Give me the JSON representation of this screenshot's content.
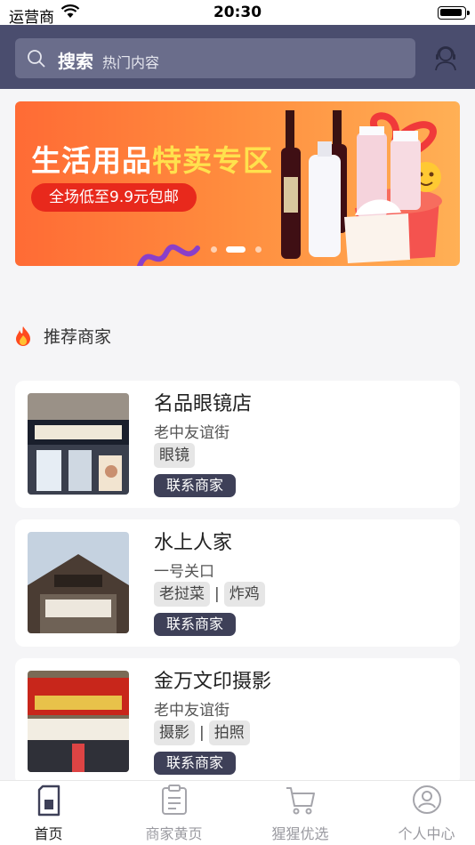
{
  "status_bar": {
    "carrier": "运营商",
    "time": "20:30"
  },
  "search": {
    "label": "搜索",
    "hint": "热门内容"
  },
  "banner": {
    "title_part1": "生活用品",
    "title_part2": "特卖专区",
    "pill_text": "全场低至9.9元包邮",
    "slide_count": 3,
    "active_slide": 1
  },
  "section": {
    "title": "推荐商家"
  },
  "merchants": [
    {
      "name": "名品眼镜店",
      "address": "老中友谊街",
      "tags": [
        "眼镜"
      ],
      "contact_label": "联系商家"
    },
    {
      "name": "水上人家",
      "address": "一号关口",
      "tags": [
        "老挝菜",
        "炸鸡"
      ],
      "contact_label": "联系商家"
    },
    {
      "name": "金万文印摄影",
      "address": "老中友谊街",
      "tags": [
        "摄影",
        "拍照"
      ],
      "contact_label": "联系商家"
    }
  ],
  "tabbar": {
    "items": [
      {
        "label": "首页",
        "icon": "home-sim-icon",
        "active": true
      },
      {
        "label": "商家黄页",
        "icon": "clipboard-icon",
        "active": false
      },
      {
        "label": "猩猩优选",
        "icon": "cart-icon",
        "active": false
      },
      {
        "label": "个人中心",
        "icon": "user-icon",
        "active": false
      }
    ]
  },
  "colors": {
    "header": "#4a4d6e",
    "accent": "#ff6b35",
    "contact_button": "#3e4058"
  }
}
